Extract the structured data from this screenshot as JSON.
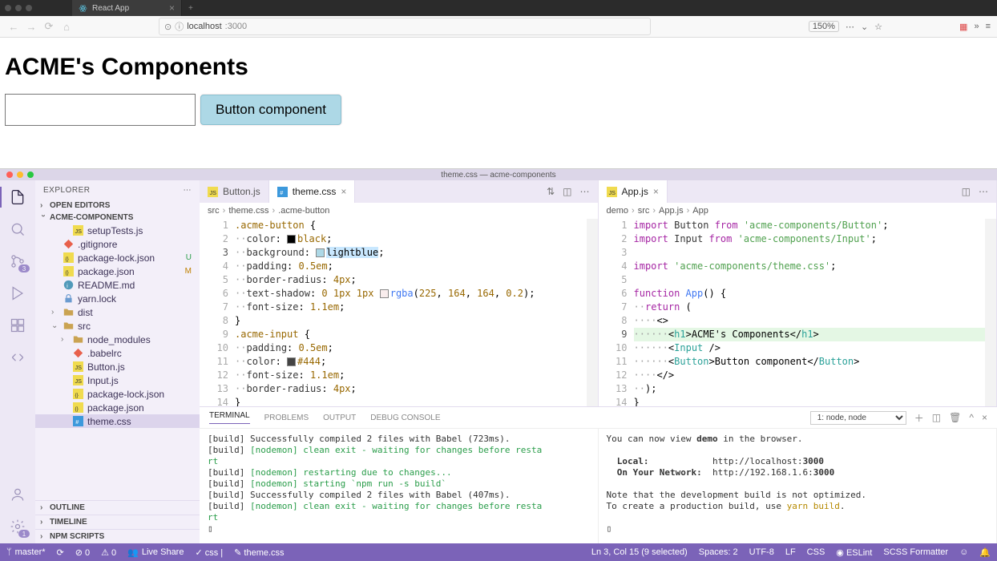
{
  "browser": {
    "tab_title": "React App",
    "url_host": "localhost",
    "url_port": ":3000",
    "zoom": "150%"
  },
  "page": {
    "heading": "ACME's Components",
    "button_label": "Button component"
  },
  "vscode": {
    "title": "theme.css — acme-components",
    "explorer_label": "EXPLORER",
    "sections": {
      "open_editors": "OPEN EDITORS",
      "project": "ACME-COMPONENTS",
      "outline": "OUTLINE",
      "timeline": "TIMELINE",
      "npm": "NPM SCRIPTS"
    },
    "tree": [
      {
        "name": "setupTests.js",
        "icon": "js",
        "depth": 1
      },
      {
        "name": ".gitignore",
        "icon": "git",
        "depth": 0
      },
      {
        "name": "package-lock.json",
        "icon": "json",
        "depth": 0,
        "status": "U",
        "statusClass": "git-u"
      },
      {
        "name": "package.json",
        "icon": "json",
        "depth": 0,
        "status": "M",
        "statusClass": "git-m"
      },
      {
        "name": "README.md",
        "icon": "md",
        "depth": 0
      },
      {
        "name": "yarn.lock",
        "icon": "lock",
        "depth": 0
      },
      {
        "name": "dist",
        "icon": "folder",
        "depth": 0,
        "chev": "›"
      },
      {
        "name": "src",
        "icon": "folder",
        "depth": 0,
        "chev": "⌄"
      },
      {
        "name": "node_modules",
        "icon": "folder",
        "depth": 1,
        "chev": "›"
      },
      {
        "name": ".babelrc",
        "icon": "git",
        "depth": 1
      },
      {
        "name": "Button.js",
        "icon": "js",
        "depth": 1
      },
      {
        "name": "Input.js",
        "icon": "js",
        "depth": 1
      },
      {
        "name": "package-lock.json",
        "icon": "json",
        "depth": 1
      },
      {
        "name": "package.json",
        "icon": "json",
        "depth": 1
      },
      {
        "name": "theme.css",
        "icon": "css",
        "depth": 1,
        "sel": true
      }
    ],
    "tabs_left": [
      {
        "label": "Button.js",
        "icon": "js"
      },
      {
        "label": "theme.css",
        "icon": "css",
        "active": true,
        "close": true
      }
    ],
    "tabs_right": [
      {
        "label": "App.js",
        "icon": "js",
        "active": true,
        "close": true
      }
    ],
    "crumbs_left": [
      "src",
      "theme.css",
      ".acme-button"
    ],
    "crumbs_right": [
      "demo",
      "src",
      "App.js",
      "App"
    ],
    "code_left": {
      "start": 1,
      "hl": 3,
      "lines": [
        "<span class='sel2'>.acme-button</span> {",
        "··<span class='p'>color</span>: <span class='colorchip' style='background:#000'></span><span class='n'>black</span>;",
        "··<span class='p'>background</span>: <span class='colorchip' style='background:#add8e6'></span><span class='hlsel'>lightblue</span>;",
        "··<span class='p'>padding</span>: <span class='n'>0.5em</span>;",
        "··<span class='p'>border-radius</span>: <span class='n'>4px</span>;",
        "··<span class='p'>text-shadow</span>: <span class='n'>0</span> <span class='n'>1px</span> <span class='n'>1px</span> <span class='colorchip' style='background:rgba(225,164,164,0.2)'></span><span class='f'>rgba</span>(<span class='n'>225</span>, <span class='n'>164</span>, <span class='n'>164</span>, <span class='n'>0.2</span>);",
        "··<span class='p'>font-size</span>: <span class='n'>1.1em</span>;",
        "}",
        "<span class='sel2'>.acme-input</span> {",
        "··<span class='p'>padding</span>: <span class='n'>0.5em</span>;",
        "··<span class='p'>color</span>: <span class='colorchip' style='background:#444'></span><span class='n'>#444</span>;",
        "··<span class='p'>font-size</span>: <span class='n'>1.1em</span>;",
        "··<span class='p'>border-radius</span>: <span class='n'>4px</span>;",
        "}"
      ]
    },
    "code_right": {
      "start": 1,
      "hl": 9,
      "lines": [
        "<span class='k'>import</span> <span class='p'>Button</span> <span class='k'>from</span> <span class='s'>'acme-components/Button'</span>;",
        "<span class='k'>import</span> <span class='p'>Input</span> <span class='k'>from</span> <span class='s'>'acme-components/Input'</span>;",
        "",
        "<span class='k'>import</span> <span class='s'>'acme-components/theme.css'</span>;",
        "",
        "<span class='k'>function</span> <span class='f'>App</span>() {",
        "··<span class='k'>return</span> (",
        "····&lt;&gt;",
        "······&lt;<span class='tag'>h1</span>&gt;ACME's Components&lt;/<span class='tag'>h1</span>&gt;",
        "······&lt;<span class='tag'>Input</span> /&gt;",
        "······&lt;<span class='tag'>Button</span>&gt;Button component&lt;/<span class='tag'>Button</span>&gt;",
        "····&lt;/&gt;",
        "··);",
        "}"
      ]
    },
    "panel": {
      "tabs": [
        "TERMINAL",
        "PROBLEMS",
        "OUTPUT",
        "DEBUG CONSOLE"
      ],
      "selector": "1: node, node",
      "left": "[build] Successfully compiled 2 files with Babel (723ms).\n[build] <span class='tg'>[nodemon] clean exit - waiting for changes before resta</span>\n<span class='tg'>rt</span>\n[build] <span class='tg'>[nodemon] restarting due to changes...</span>\n[build] <span class='tg'>[nodemon] starting `npm run -s build`</span>\n[build] Successfully compiled 2 files with Babel (407ms).\n[build] <span class='tg'>[nodemon] clean exit - waiting for changes before resta</span>\n<span class='tg'>rt</span>\n▯",
      "right": "You can now view <b>demo</b> in the browser.\n\n  <b>Local:</b>            http://localhost:<b>3000</b>\n  <b>On Your Network:</b>  http://192.168.1.6:<b>3000</b>\n\nNote that the development build is not optimized.\nTo create a production build, use <span class='ty'>yarn build</span>.\n\n▯"
    },
    "status": {
      "branch": "master*",
      "sync": "⟳",
      "errors": "⊘ 0",
      "warnings": "⚠ 0",
      "liveshare": "Live Share",
      "lint": "✓ css |",
      "file": "✎ theme.css",
      "pos": "Ln 3, Col 15 (9 selected)",
      "spaces": "Spaces: 2",
      "enc": "UTF-8",
      "eol": "LF",
      "lang": "CSS",
      "eslint": "◉ ESLint",
      "scss": "SCSS Formatter",
      "bell": "🔔"
    },
    "activity_badges": {
      "scm": "3",
      "settings": "1"
    }
  }
}
